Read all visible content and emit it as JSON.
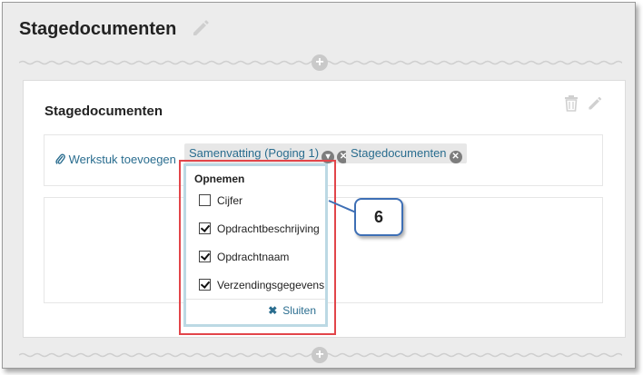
{
  "page": {
    "title": "Stagedocumenten"
  },
  "section": {
    "title": "Stagedocumenten"
  },
  "attachments": {
    "add_label": "Werkstuk toevoegen",
    "tags": [
      {
        "label": "Samenvatting (Poging 1)"
      },
      {
        "label": "Stagedocumenten"
      }
    ]
  },
  "dropdown": {
    "heading": "Opnemen",
    "options": [
      {
        "label": "Cijfer",
        "checked": false
      },
      {
        "label": "Opdrachtbeschrijving",
        "checked": true
      },
      {
        "label": "Opdrachtnaam",
        "checked": true
      },
      {
        "label": "Verzendingsgegevens",
        "checked": true
      }
    ],
    "close_label": "Sluiten"
  },
  "callout": {
    "number": "6"
  },
  "colors": {
    "link": "#2a6d8f",
    "highlight_border": "#e2454a",
    "callout_border": "#3e6fb5",
    "dropdown_border": "#bcd9e4"
  },
  "icons": {
    "title_edit": "pencil-icon",
    "add_block": "plus-icon",
    "delete": "trash-icon",
    "edit": "pencil-icon",
    "attach": "paperclip-icon",
    "options": "chevron-down-icon",
    "remove": "close-icon"
  }
}
